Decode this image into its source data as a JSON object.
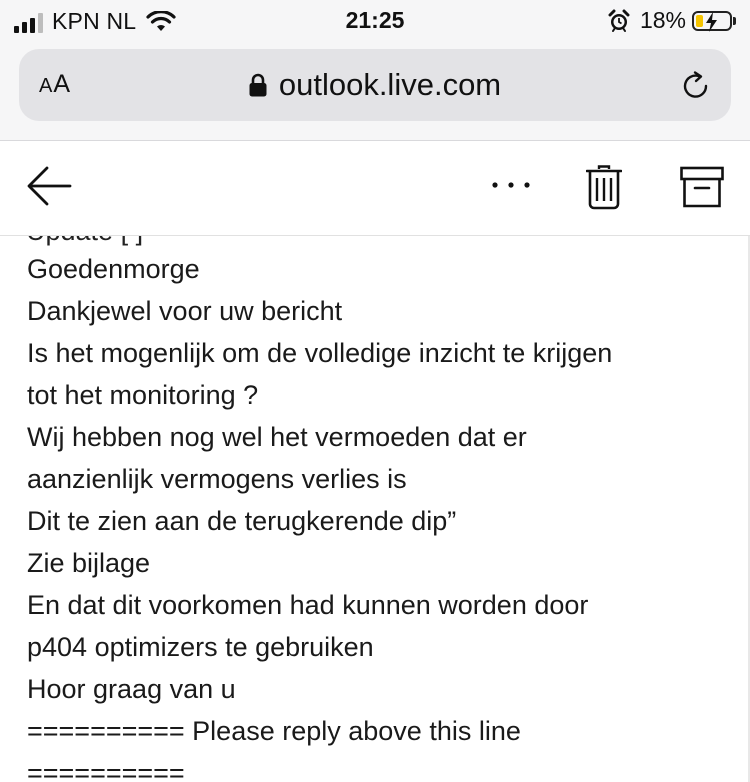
{
  "status_bar": {
    "carrier": "KPN NL",
    "time": "21:25",
    "battery_percent": "18%",
    "battery_level": 0.18,
    "icons": [
      "signal-icon",
      "wifi-icon",
      "alarm-icon",
      "battery-charging-icon"
    ]
  },
  "browser": {
    "text_size_label_small": "A",
    "text_size_label_large": "A",
    "url": "outlook.live.com",
    "icons": [
      "lock-icon",
      "reload-icon"
    ]
  },
  "toolbar": {
    "icons": [
      "back-arrow-icon",
      "more-options-icon",
      "trash-icon",
      "archive-icon"
    ]
  },
  "email": {
    "cut_off_line": "Update [  ]",
    "lines": [
      " Goedenmorge",
      "Dankjewel voor uw bericht",
      "Is het mogenlijk om de volledige inzicht te krijgen",
      "tot het monitoring ?",
      "Wij hebben nog wel het vermoeden dat er",
      "aanzienlijk vermogens verlies is",
      "Dit te zien aan de terugkerende dip”",
      "Zie bijlage",
      "En dat dit voorkomen had kunnen worden door",
      "p404 optimizers te gebruiken",
      "Hoor graag van u",
      "========== Please reply above this line",
      "=========="
    ]
  },
  "colors": {
    "chrome_bg": "#f6f6f7",
    "url_bar_bg": "#e3e3e6",
    "battery_fill": "#f5c400",
    "text": "#1a1a1a"
  }
}
